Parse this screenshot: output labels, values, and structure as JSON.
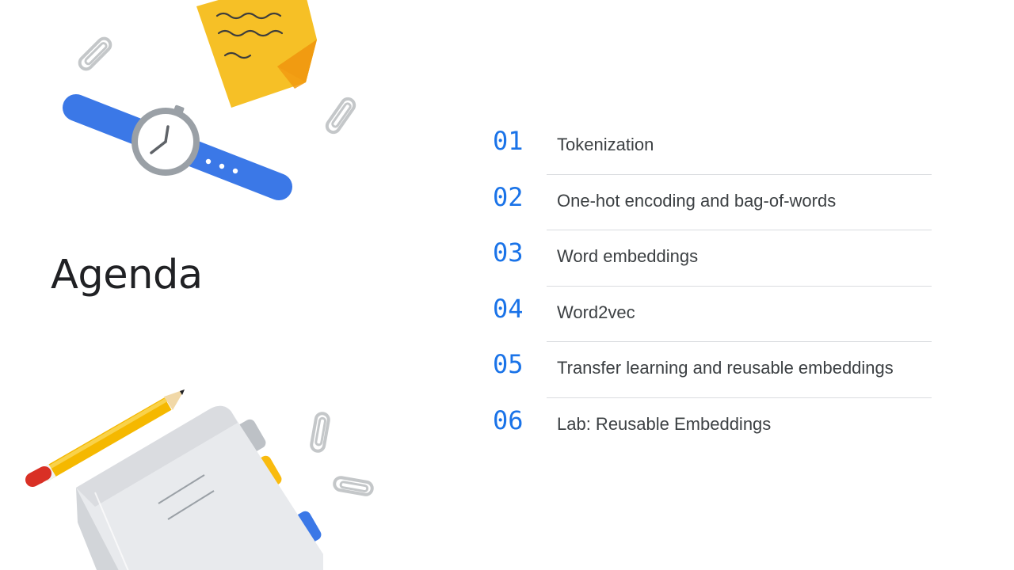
{
  "title": "Agenda",
  "agenda": [
    {
      "number": "01",
      "label": "Tokenization"
    },
    {
      "number": "02",
      "label": "One-hot encoding and bag-of-words"
    },
    {
      "number": "03",
      "label": "Word embeddings"
    },
    {
      "number": "04",
      "label": "Word2vec"
    },
    {
      "number": "05",
      "label": "Transfer learning and reusable embeddings"
    },
    {
      "number": "06",
      "label": "Lab: Reusable Embeddings"
    }
  ],
  "colors": {
    "accent": "#1a73e8",
    "title": "#202124",
    "text": "#3c4043",
    "divider": "#dadce0",
    "sticky_note": "#f6c026",
    "pencil": "#f5b800",
    "watch_band": "#3b78e7"
  },
  "icons": [
    "sticky-note-icon",
    "wristwatch-icon",
    "paperclip-icon",
    "pencil-icon",
    "notebook-icon"
  ]
}
